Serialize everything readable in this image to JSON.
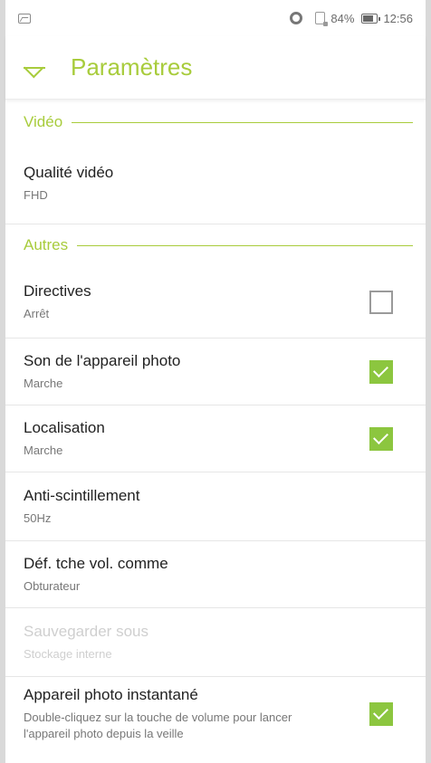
{
  "status_bar": {
    "battery_percent": "84%",
    "time": "12:56"
  },
  "app_bar": {
    "title": "Paramètres"
  },
  "sections": {
    "video": {
      "label": "Vidéo"
    },
    "other": {
      "label": "Autres"
    }
  },
  "items": {
    "video_quality": {
      "title": "Qualité vidéo",
      "subtitle": "FHD"
    },
    "guidelines": {
      "title": "Directives",
      "subtitle": "Arrêt",
      "checked": false
    },
    "shutter_sound": {
      "title": "Son de l'appareil photo",
      "subtitle": "Marche",
      "checked": true
    },
    "location": {
      "title": "Localisation",
      "subtitle": "Marche",
      "checked": true
    },
    "anti_flicker": {
      "title": "Anti-scintillement",
      "subtitle": "50Hz"
    },
    "volume_key": {
      "title": "Déf. tche vol. comme",
      "subtitle": "Obturateur"
    },
    "save_to": {
      "title": "Sauvegarder sous",
      "subtitle": "Stockage interne",
      "disabled": true
    },
    "instant_camera": {
      "title": "Appareil photo instantané",
      "subtitle": "Double-cliquez sur la touche de volume pour lancer l'appareil photo depuis la veille",
      "checked": true
    }
  },
  "colors": {
    "accent": "#a8cc3c",
    "checkbox_on": "#8cc63f"
  }
}
